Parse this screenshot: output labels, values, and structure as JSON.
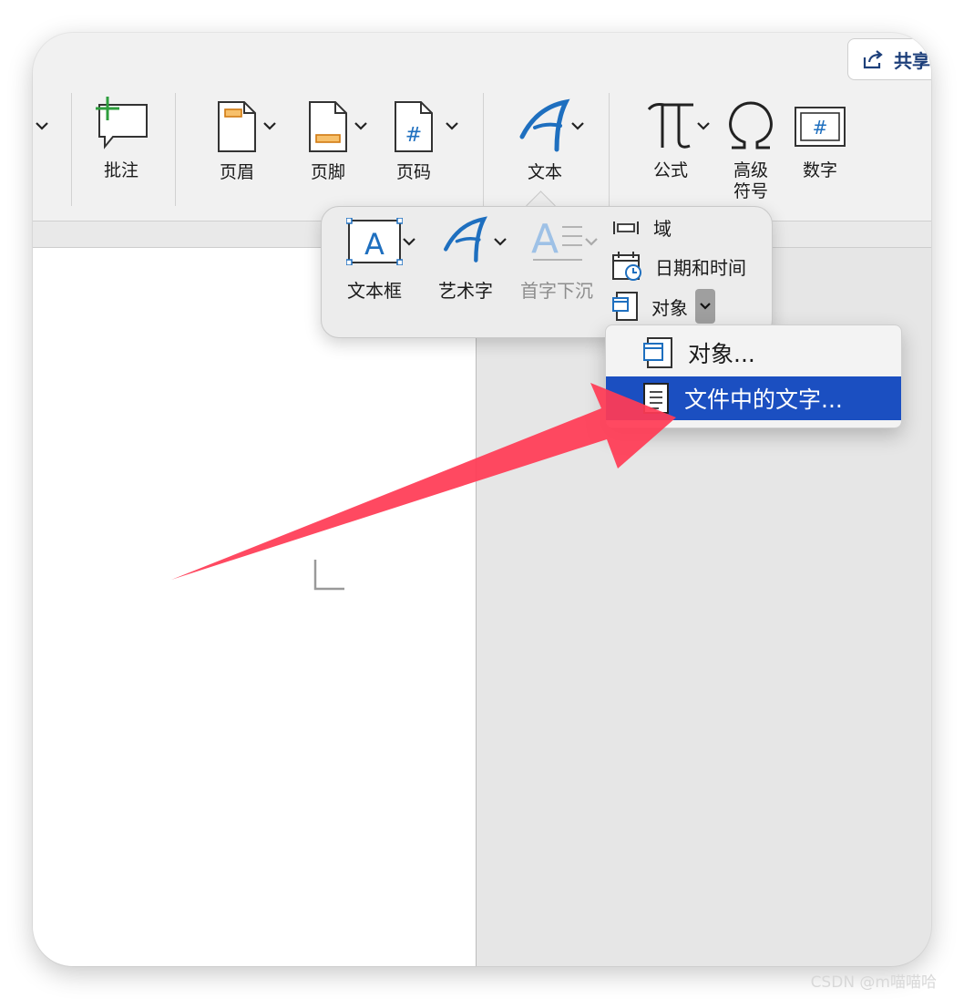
{
  "share_label": "共享",
  "ribbon": {
    "comment_label": "批注",
    "header_label": "页眉",
    "footer_label": "页脚",
    "page_number_label": "页码",
    "text_label": "文本",
    "formula_label": "公式",
    "symbols_label": "高级\n符号",
    "number_label": "数字"
  },
  "text_popover": {
    "textbox_label": "文本框",
    "wordart_label": "艺术字",
    "dropcap_label": "首字下沉",
    "field_label": "域",
    "datetime_label": "日期和时间",
    "object_label": "对象"
  },
  "object_menu": {
    "items": [
      {
        "label": "对象..."
      },
      {
        "label": "文件中的文字...",
        "selected": true
      }
    ]
  },
  "watermark": "CSDN @m喵喵哈",
  "colors": {
    "accent_blue": "#1E6FBF",
    "menu_highlight": "#1B4FC1",
    "annotation_arrow": "#FF3B55",
    "comment_plus": "#2E9E3E"
  }
}
